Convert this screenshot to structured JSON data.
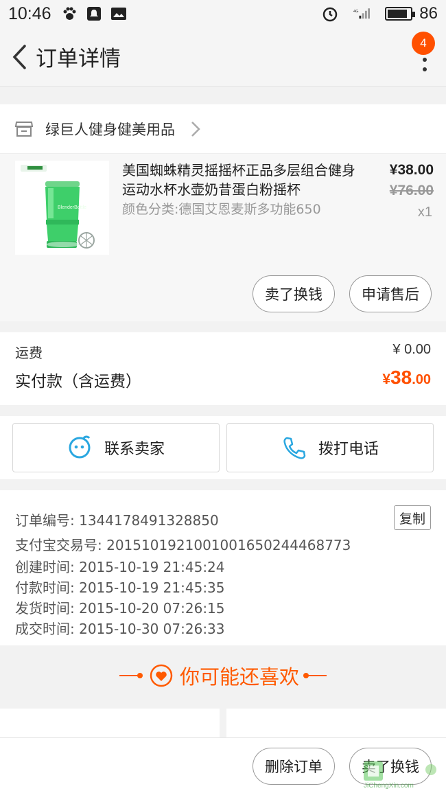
{
  "status_bar": {
    "time": "10:46",
    "battery": "86",
    "battery_fraction": 0.86,
    "network": "4G"
  },
  "header": {
    "title": "订单详情",
    "badge_count": "4"
  },
  "shop": {
    "name": "绿巨人健身健美用品"
  },
  "product": {
    "name": "美国蜘蛛精灵摇摇杯正品多层组合健身运动水杯水壶奶昔蛋白粉摇杯",
    "sku": "颜色分类:德国艾恩麦斯多功能650",
    "price": "¥38.00",
    "original_price": "¥76.00",
    "quantity": "x1",
    "resell_button": "卖了换钱",
    "aftersale_button": "申请售后"
  },
  "fees": {
    "shipping_label": "运费",
    "shipping_value": "¥ 0.00",
    "total_label": "实付款（含运费）",
    "total_currency": "¥",
    "total_integer": "38",
    "total_decimal": ".00"
  },
  "contact": {
    "seller_button": "联系卖家",
    "phone_button": "拨打电话"
  },
  "order_info": {
    "copy_button": "复制",
    "lines": [
      "订单编号: 1344178491328850",
      "支付宝交易号: 2015101921001001650244468773",
      "创建时间: 2015-10-19 21:45:24",
      "付款时间: 2015-10-19 21:45:35",
      "发货时间: 2015-10-20 07:26:15",
      "成交时间: 2015-10-30 07:26:33"
    ]
  },
  "recommend": {
    "title": "你可能还喜欢"
  },
  "bottom_bar": {
    "delete_button": "删除订单",
    "resell_button": "卖了换钱"
  },
  "watermark": {
    "text": "JiChengXin.com"
  },
  "colors": {
    "accent": "#ff5000",
    "contact_icon": "#2aa7e0"
  }
}
